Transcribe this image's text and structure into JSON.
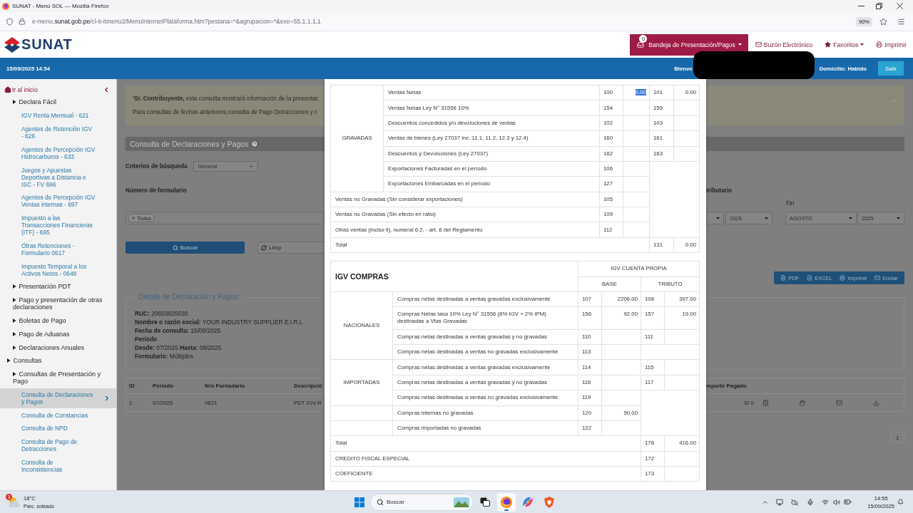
{
  "browser": {
    "title": "SUNAT - Menú SOL — Mozilla Firefox",
    "url": {
      "prefix": "e-menu.",
      "domain": "sunat.gob.pe",
      "path": "/cl-ti-itmenu2/MenuInternetPlataforma.htm?pestana=*&agrupacion=*&exe=55.1.1.1.1"
    },
    "zoom": "90%"
  },
  "header": {
    "logo": "SUNAT",
    "inbox_button": {
      "label": "Bandeja de Presentación/Pagos",
      "count": "0"
    },
    "links": [
      {
        "kind": "mail",
        "label": "Buzón Electrónico",
        "dropdown": false
      },
      {
        "kind": "favorites",
        "label": "Favoritos",
        "dropdown": true
      },
      {
        "kind": "print",
        "label": "Imprimir",
        "dropdown": false
      }
    ]
  },
  "user_bar": {
    "datetime": "15/09/2025 14:54",
    "greeting": "Bienve",
    "address_status": "Domicilio: Habido",
    "logout": "Salir"
  },
  "sidebar": {
    "home_link": "Ir al inicio",
    "open_section_items": [
      {
        "kind": "group",
        "label": "Declara Fácil",
        "children": [
          {
            "kind": "link",
            "label": "IGV Renta Mensual - 621",
            "selected": false
          },
          {
            "kind": "link",
            "label": "Agentes de Retención IGV - 626",
            "selected": false
          },
          {
            "kind": "link",
            "label": "Agentes de Percepción IGV Hidrocarburos - 633",
            "selected": false
          },
          {
            "kind": "link",
            "label": "Juegos y Apuestas Deportivas a Distancia e ISC - FV 696",
            "selected": false
          },
          {
            "kind": "link",
            "label": "Agentes de Percepción IGV Ventas internas - 697",
            "selected": false
          },
          {
            "kind": "link",
            "label": "Impuesto a las Transacciones Financieras (ITF) - 695",
            "selected": false
          },
          {
            "kind": "link",
            "label": "Otras Retenciones - Formulario 0617",
            "selected": false
          },
          {
            "kind": "link",
            "label": "Impuesto Temporal a los Activos Netos - 0648",
            "selected": false
          }
        ]
      },
      {
        "kind": "group",
        "label": "Presentación PDT"
      },
      {
        "kind": "group",
        "label": "Pago y presentación de otras declaraciones"
      },
      {
        "kind": "group",
        "label": "Boletas de Pago"
      },
      {
        "kind": "group",
        "label": "Pago de Aduanas"
      },
      {
        "kind": "group",
        "label": "Declaraciones Anuales"
      }
    ],
    "items": [
      {
        "kind": "group",
        "label": "Consultas",
        "children": [
          {
            "kind": "group",
            "label": "Consultas de Presentación y Pago",
            "children": [
              {
                "kind": "link",
                "label": "Consulta de Declaraciones y Pagos",
                "selected": true
              },
              {
                "kind": "link",
                "label": "Consulta de Constancias",
                "selected": false
              },
              {
                "kind": "link",
                "label": "Consulta de NPD",
                "selected": false
              },
              {
                "kind": "link",
                "label": "Consulta de Pago de Detracciones",
                "selected": false
              },
              {
                "kind": "link",
                "label": "Consulta de Inconsistencias",
                "selected": false
              }
            ]
          }
        ]
      }
    ]
  },
  "page": {
    "notice": {
      "lines": [
        "**'Sr. Contribuyente,** esta consulta mostrará información de la presentac",
        "Para consultas de fechas anteriores,consulta de Pago Detracciones y c"
      ]
    },
    "title": "Consulta de Declaraciones y Pagos",
    "search_criteria": {
      "label": "Criterios de búsqueda",
      "value": "General"
    },
    "form_number": {
      "label": "Número de formulario",
      "tags": [
        "Todos"
      ]
    },
    "period": {
      "label": "tributario",
      "start_year": "2025",
      "end_label": "Fin",
      "end_month": "AGOSTO",
      "end_year": "2025"
    },
    "buttons": [
      {
        "kind": "search",
        "label": "Buscar"
      },
      {
        "kind": "clear",
        "label": "Limp"
      }
    ],
    "exports": [
      {
        "kind": "pdf",
        "label": "PDF"
      },
      {
        "kind": "excel",
        "label": "EXCEL"
      },
      {
        "kind": "print",
        "label": "Imprimir"
      },
      {
        "kind": "send",
        "label": "Enviar"
      }
    ],
    "detail": {
      "legend": "Detalle de Declaración y Pagos:",
      "lines": [
        {
          "kind": "field",
          "text": "**RUC:** 20603825030"
        },
        {
          "kind": "field",
          "text": "**Nombre o razón social:** YOUR INDUSTRY SUPPLIER E.I.R.L"
        },
        {
          "kind": "field",
          "text": "**Fecha de consulta:** 15/09/2025"
        },
        {
          "kind": "heading",
          "text": "Período"
        },
        {
          "kind": "field",
          "text": "**Desde:** 07/2025 **Hasta:** 08/2025"
        },
        {
          "kind": "field",
          "text": "**Formulario:** Múltiples"
        }
      ]
    },
    "results": {
      "columns": [
        "ID",
        "Período",
        "Nro Formulario",
        "Descripció"
      ],
      "amount_column": "mporte Pagado",
      "rows": [
        {
          "cells": [
            "1",
            "07/2025",
            "0621",
            "PDT IGV-R"
          ],
          "amount": "S/ 0"
        }
      ]
    },
    "pagination": [
      "1"
    ]
  },
  "modal": {
    "sales_table": {
      "rows": [
        {
          "kind": "group",
          "label": "GRAVADAS",
          "rows": [
            {
              "label": "Ventas Netas",
              "base_code": "100",
              "base": "0.00",
              "base_highlighted": true,
              "tax_code": "101",
              "tax": "0.00"
            },
            {
              "label": "Ventas Netas Ley N° 31556 10%",
              "base_code": "154",
              "tax_code": "155"
            },
            {
              "label": "Descuentos concedidos y/o devoluciones de ventas",
              "base_code": "102",
              "tax_code": "103"
            },
            {
              "label": "Ventas de bienes (Ley 27037 inc. 11.1, 11.2, 12.3 y 12.4)",
              "base_code": "160",
              "tax_code": "161"
            },
            {
              "label": "Descuentos y Devoluciones (Ley 27037)",
              "base_code": "162",
              "tax_code": "163"
            },
            {
              "label": "Exportaciones Facturadas en el período",
              "base_code": "106"
            },
            {
              "label": "Exportaciones Embarcadas en el período",
              "base_code": "127"
            }
          ]
        },
        {
          "kind": "line",
          "label": "Ventas no Gravadas (Sin considerar exportaciones)",
          "base_code": "105"
        },
        {
          "kind": "line",
          "label": "Ventas no Gravadas (Sin efecto en ratio)",
          "base_code": "109"
        },
        {
          "kind": "line",
          "label": "Otras ventas (inciso ii), numeral 6.2, - art. 6 del Reglamento",
          "base_code": "112"
        },
        {
          "kind": "total",
          "label": "Total",
          "tax_code": "131",
          "tax": "0.00"
        }
      ]
    },
    "purchases_table": {
      "title": "IGV COMPRAS",
      "group_header": "IGV CUENTA PROPIA",
      "columns": [
        "BASE",
        "TRIBUTO"
      ],
      "rows": [
        {
          "kind": "group",
          "label": "NACIONALES",
          "rows": [
            {
              "label": "Compras netas destinadas a ventas gravadas exclusivamente",
              "base_code": "107",
              "base": "2206.00",
              "tax_code": "108",
              "tax": "397.00"
            },
            {
              "label": "Compras Netas tasa 10% Ley N° 31556 (8% IGV + 2% IPM) destinadas a Vtas Gravadas",
              "base_code": "156",
              "base": "92.00",
              "tax_code": "157",
              "tax": "19.00"
            },
            {
              "label": "Compras netas destinadas a ventas gravadas y no gravadas",
              "base_code": "110",
              "tax_code": "111"
            },
            {
              "label": "Compras netas destinadas a ventas no gravadas exclusivamente",
              "base_code": "113"
            }
          ]
        },
        {
          "kind": "group",
          "label": "IMPORTADAS",
          "rows": [
            {
              "label": "Compras netas destinadas a ventas gravadas exclusivamente",
              "base_code": "114",
              "tax_code": "115"
            },
            {
              "label": "Compras netas destinadas a ventas gravadas y no gravadas",
              "base_code": "116",
              "tax_code": "117"
            },
            {
              "label": "Compras netas destinadas a ventas no gravadas exclusivamente",
              "base_code": "119"
            }
          ]
        },
        {
          "kind": "ungrouped",
          "label": "Compras internas no gravadas",
          "base_code": "120",
          "base": "50.00"
        },
        {
          "kind": "ungrouped",
          "label": "Compras importadas no gravadas",
          "base_code": "122"
        },
        {
          "kind": "total",
          "label": "Total",
          "tax_code": "178",
          "tax": "416.00"
        },
        {
          "kind": "total",
          "label": "CREDITO FISCAL ESPECIAL",
          "tax_code": "172"
        },
        {
          "kind": "total",
          "label": "COEFICIENTE",
          "tax_code": "173"
        }
      ]
    }
  },
  "taskbar": {
    "weather": {
      "temperature": "18°C",
      "condition": "Parc. soleado",
      "alerts": "3"
    },
    "search": {
      "placeholder": "Buscar"
    },
    "apps": [
      {
        "kind": "task_view",
        "selected": false
      },
      {
        "kind": "browser",
        "selected": true
      },
      {
        "kind": "assistant",
        "selected": false
      },
      {
        "kind": "app",
        "selected": false
      }
    ],
    "clock": {
      "time": "14:55",
      "date": "15/09/2025"
    }
  }
}
